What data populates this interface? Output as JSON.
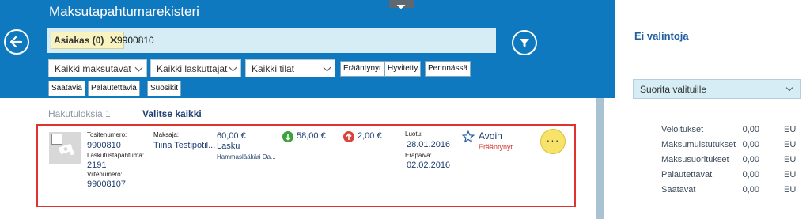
{
  "app": {
    "title": "Maksutapahtumarekisteri"
  },
  "search": {
    "chip_label": "Asiakas (0)",
    "chip_remove": "✕",
    "value": "9900810"
  },
  "filters": {
    "dropdowns": [
      "Kaikki maksutavat",
      "Kaikki laskuttajat",
      "Kaikki tilat"
    ],
    "tags": [
      "Erääntynyt",
      "Hyvitetty",
      "Perinnässä",
      "Saatavia",
      "Palautettavia",
      "Suosikit"
    ]
  },
  "results": {
    "count_label": "Hakutuloksia 1",
    "select_all": "Valitse kaikki",
    "items": [
      {
        "tositenumero_label": "Tositenumero:",
        "tositenumero": "9900810",
        "laskutustapahtuma_label": "Laskutustapahtuma:",
        "laskutustapahtuma": "2191",
        "viitenumero_label": "Viitenumero:",
        "viitenumero": "99008107",
        "maksaja_label": "Maksaja:",
        "maksaja": "Tiina Testipotil...",
        "amount": "60,00 €",
        "type": "Lasku",
        "biller": "Hammaslääkäri Da...",
        "incoming": "58,00 €",
        "outgoing": "2,00 €",
        "luotu_label": "Luotu:",
        "luotu": "28.01.2016",
        "erapaiva_label": "Eräpäivä:",
        "erapaiva": "02.02.2016",
        "status": "Avoin",
        "status_sub": "Erääntynyt",
        "more": "···"
      }
    ]
  },
  "side": {
    "title": "Ei valintoja",
    "action_select": "Suorita valituille",
    "rows": [
      {
        "label": "Veloitukset",
        "amount": "0,00",
        "currency": "EU"
      },
      {
        "label": "Maksumuistutukset",
        "amount": "0,00",
        "currency": "EU"
      },
      {
        "label": "Maksusuoritukset",
        "amount": "0,00",
        "currency": "EU"
      },
      {
        "label": "Palautettavat",
        "amount": "0,00",
        "currency": "EU"
      },
      {
        "label": "Saatavat",
        "amount": "0,00",
        "currency": "EU"
      }
    ]
  },
  "colors": {
    "header": "#0f79c0",
    "search_bg": "#d6edf6",
    "chip_bg": "#f8f3bf",
    "card_border": "#e0322f",
    "incoming": "#3aa33a",
    "outgoing": "#d9443a",
    "more_btn": "#f7e36a"
  },
  "icons": {
    "back": "arrow-left-circle-icon",
    "filter": "funnel-icon",
    "favorite": "star-outline-icon",
    "thumb": "money-icon",
    "incoming": "arrow-down-circle-icon",
    "outgoing": "arrow-up-circle-icon"
  }
}
